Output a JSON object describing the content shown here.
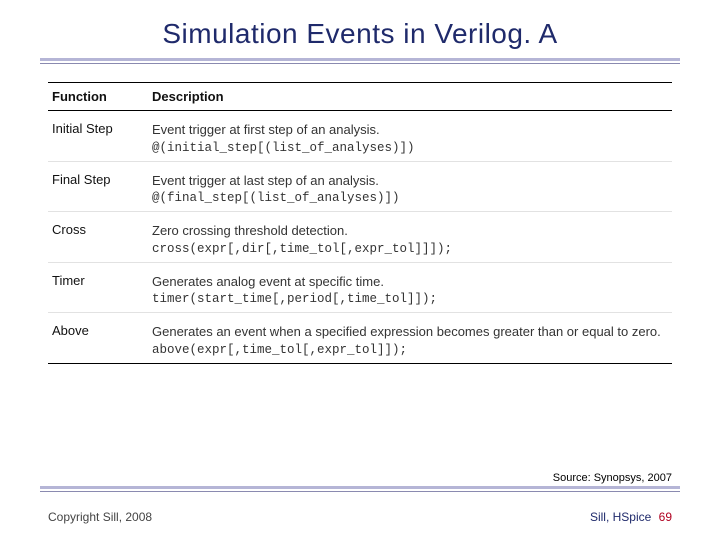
{
  "title": "Simulation Events in Verilog. A",
  "table": {
    "headers": {
      "func": "Function",
      "desc": "Description"
    },
    "rows": [
      {
        "func": "Initial Step",
        "desc": "Event trigger at first step of an analysis.",
        "code": "@(initial_step[(list_of_analyses)])"
      },
      {
        "func": "Final Step",
        "desc": "Event trigger at last step of an analysis.",
        "code": "@(final_step[(list_of_analyses)])"
      },
      {
        "func": "Cross",
        "desc": "Zero crossing threshold detection.",
        "code": "cross(expr[,dir[,time_tol[,expr_tol]]]);"
      },
      {
        "func": "Timer",
        "desc": "Generates analog event at specific time.",
        "code": "timer(start_time[,period[,time_tol]]);"
      },
      {
        "func": "Above",
        "desc": "Generates an event when a specified expression becomes greater than or equal to zero.",
        "code": "above(expr[,time_tol[,expr_tol]]);"
      }
    ]
  },
  "source": "Source: Synopsys, 2007",
  "footer": {
    "left": "Copyright Sill, 2008",
    "right_label": "Sill, HSpice",
    "page": "69"
  }
}
